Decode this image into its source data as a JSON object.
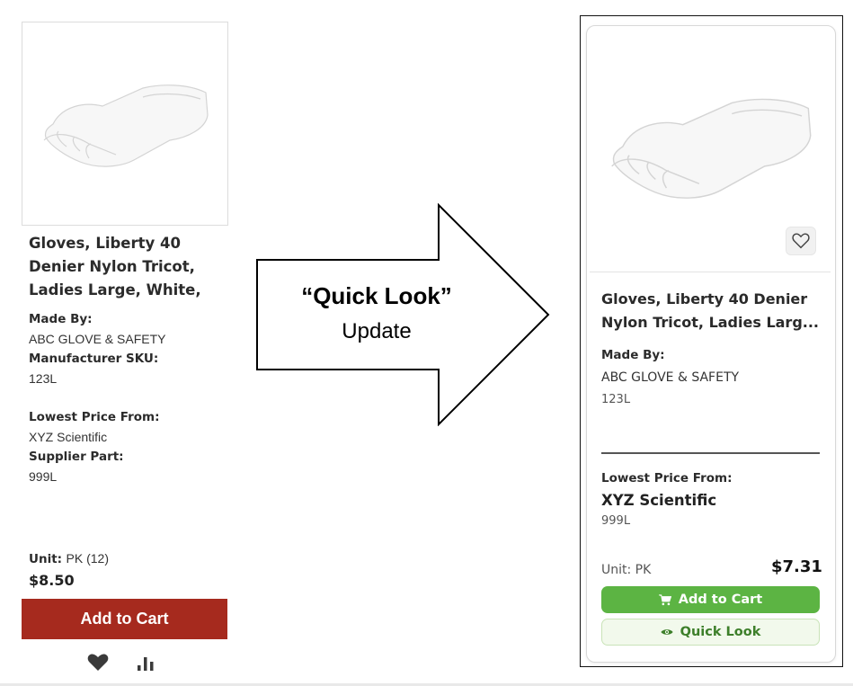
{
  "old_card": {
    "title_line1": "Gloves, Liberty 40",
    "title_line2": "Denier Nylon Tricot,",
    "title_line3": "Ladies Large, White,",
    "made_by_label": "Made By:",
    "made_by_value": "ABC GLOVE & SAFETY",
    "mfr_sku_label": "Manufacturer SKU:",
    "mfr_sku_value": "123L",
    "lowest_price_label": "Lowest Price From:",
    "supplier": "XYZ Scientific",
    "supplier_part_label": "Supplier Part:",
    "supplier_part_value": "999L",
    "unit_label": "Unit:",
    "unit_value": "PK (12)",
    "price": "$8.50",
    "add_to_cart_label": "Add to Cart",
    "icons": [
      "heart-icon",
      "bar-chart-icon"
    ]
  },
  "arrow": {
    "title": "“Quick Look”",
    "subtitle": "Update"
  },
  "new_card": {
    "title_line1": "Gloves, Liberty 40 Denier",
    "title_line2": "Nylon Tricot, Ladies Larg...",
    "made_by_label": "Made By:",
    "made_by_value": "ABC GLOVE & SAFETY",
    "mfr_sku_value": "123L",
    "lowest_price_label": "Lowest Price From:",
    "supplier": "XYZ Scientific",
    "supplier_part_value": "999L",
    "unit_label": "Unit: PK",
    "price": "$7.31",
    "add_to_cart_label": "Add to Cart",
    "quick_look_label": "Quick Look",
    "icons": [
      "heart-outline-icon",
      "cart-icon",
      "eye-icon"
    ]
  },
  "colors": {
    "old_cart_bg": "#a62a1e",
    "new_cart_bg": "#5cb443",
    "quick_look_bg": "#f2f9ec",
    "quick_look_text": "#3d7f2a"
  }
}
